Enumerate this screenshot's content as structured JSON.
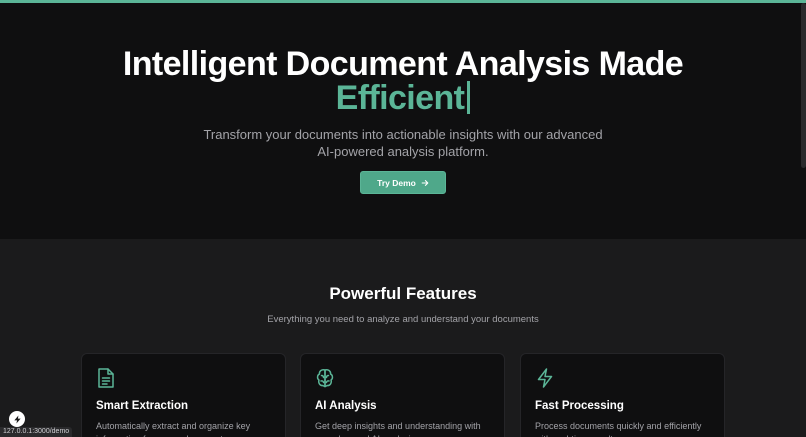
{
  "hero": {
    "title_line1": "Intelligent Document Analysis Made",
    "title_line2": "Efficient",
    "subtitle": "Transform your documents into actionable insights with our advanced AI-powered analysis platform.",
    "cta_label": "Try Demo",
    "cta_icon": "arrow-right-icon"
  },
  "features": {
    "title": "Powerful Features",
    "subtitle": "Everything you need to analyze and understand your documents",
    "cards": [
      {
        "icon": "document-icon",
        "title": "Smart Extraction",
        "description": "Automatically extract and organize key information from your documents"
      },
      {
        "icon": "brain-icon",
        "title": "AI Analysis",
        "description": "Get deep insights and understanding with our advanced AI analysis"
      },
      {
        "icon": "lightning-icon",
        "title": "Fast Processing",
        "description": "Process documents quickly and efficiently with real-time results"
      }
    ]
  },
  "status_bar": {
    "url": "127.0.0.1:3000/demo"
  },
  "colors": {
    "accent": "#5bb597",
    "hero_bg": "#0f0f10",
    "section_bg": "#1b1b1c",
    "muted_text": "#a3a3a8"
  }
}
